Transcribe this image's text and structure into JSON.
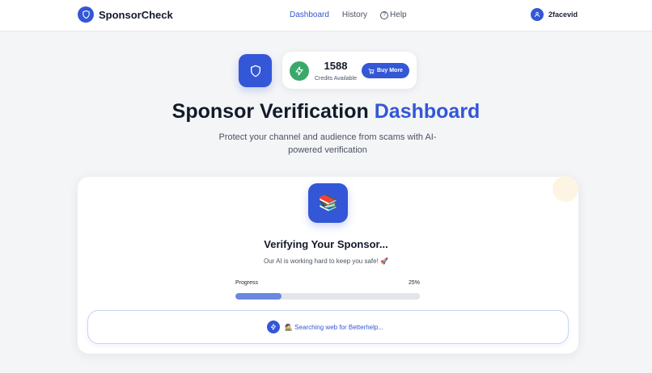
{
  "app": {
    "brand": "SponsorCheck",
    "accent_color": "#3357d6",
    "success_color": "#3aa86a"
  },
  "nav": {
    "links": [
      {
        "label": "Dashboard",
        "active": true
      },
      {
        "label": "History",
        "active": false
      },
      {
        "label": "Help",
        "active": false,
        "icon": "help-circle-icon"
      }
    ],
    "user": {
      "name": "2facevid",
      "icon": "user-icon"
    }
  },
  "credits": {
    "count": "1588",
    "label": "Credits Available",
    "buy_label": "Buy More"
  },
  "hero": {
    "title_main": "Sponsor Verification",
    "title_accent": "Dashboard",
    "subtitle": "Protect your channel and audience from scams with AI-powered verification"
  },
  "verification": {
    "emoji": "📚",
    "title": "Verifying Your Sponsor...",
    "subtitle": "Our AI is working hard to keep you safe! 🚀",
    "progress_label": "Progress",
    "progress_pct_text": "25%",
    "progress": 0.25,
    "status_text": "🕵️ Searching web for Betterhelp..."
  }
}
